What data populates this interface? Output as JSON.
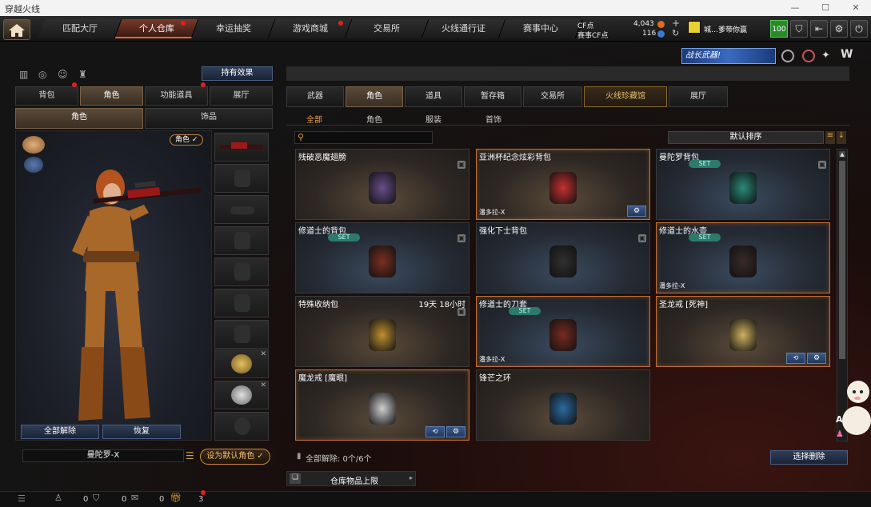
{
  "window": {
    "title": "穿越火线",
    "minimize": "—",
    "maximize": "☐",
    "close": "✕"
  },
  "nav": {
    "tabs": [
      "匹配大厅",
      "个人仓库",
      "幸运抽奖",
      "游戏商城",
      "交易所",
      "火线通行证",
      "赛事中心"
    ],
    "active_index": 1
  },
  "currency": {
    "cf_label": "CF点",
    "cf_value": "4,043",
    "match_cf_label": "赛事CF点",
    "match_cf_value": "116"
  },
  "player": {
    "name": "城…爹带你赢",
    "level": "100"
  },
  "banner": {
    "text": "战长武器!"
  },
  "left": {
    "effect_button": "持有效果",
    "tabs": [
      "背包",
      "角色",
      "功能道具",
      "展厅"
    ],
    "active_tab": 1,
    "subtabs": [
      "角色",
      "饰品"
    ],
    "role_badge": "角色 ✓",
    "unequip_all": "全部解除",
    "restore": "恢复",
    "character_name": "曼陀罗-X",
    "set_default": "设为默认角色 ✓"
  },
  "right": {
    "tabs": [
      "武器",
      "角色",
      "道具",
      "暂存箱",
      "交易所",
      "火线珍藏馆",
      "展厅"
    ],
    "active_tab": 1,
    "special_tab": 5,
    "subtabs": [
      "全部",
      "角色",
      "服装",
      "首饰"
    ],
    "active_subtab": 0,
    "search_placeholder": "",
    "sort_label": "默认排序",
    "items": [
      {
        "name": "残破恶魔翅膀",
        "time": "",
        "set": false,
        "owner": "",
        "style": "brown",
        "selected": false,
        "lock": true,
        "gear": false,
        "convert": false
      },
      {
        "name": "亚洲杯纪念炫彩背包",
        "time": "",
        "set": false,
        "owner": "潘多拉-X",
        "style": "brown",
        "selected": true,
        "lock": false,
        "gear": true,
        "convert": false
      },
      {
        "name": "曼陀罗背包",
        "time": "",
        "set": true,
        "owner": "",
        "style": "blue",
        "selected": false,
        "lock": true,
        "gear": false,
        "convert": false
      },
      {
        "name": "修道士的背包",
        "time": "",
        "set": true,
        "owner": "",
        "style": "blue",
        "selected": false,
        "lock": true,
        "gear": false,
        "convert": false
      },
      {
        "name": "强化下士背包",
        "time": "",
        "set": false,
        "owner": "",
        "style": "blue",
        "selected": false,
        "lock": true,
        "gear": false,
        "convert": false
      },
      {
        "name": "修道士的水壶",
        "time": "",
        "set": true,
        "owner": "潘多拉-X",
        "style": "blue",
        "selected": true,
        "lock": false,
        "gear": false,
        "convert": false
      },
      {
        "name": "特殊收纳包",
        "time": "19天 18小时",
        "set": false,
        "owner": "",
        "style": "brown",
        "selected": false,
        "lock": true,
        "gear": false,
        "convert": false
      },
      {
        "name": "修道士的刀套",
        "time": "",
        "set": true,
        "owner": "潘多拉-X",
        "style": "blue",
        "selected": true,
        "lock": false,
        "gear": false,
        "convert": false
      },
      {
        "name": "圣龙戒 [死神]",
        "time": "",
        "set": false,
        "owner": "",
        "style": "brown",
        "selected": true,
        "lock": false,
        "gear": true,
        "convert": true
      },
      {
        "name": "魔龙戒 [魔眼]",
        "time": "",
        "set": false,
        "owner": "",
        "style": "brown",
        "selected": true,
        "lock": false,
        "gear": true,
        "convert": true
      },
      {
        "name": "锋芒之环",
        "time": "",
        "set": false,
        "owner": "",
        "style": "brown",
        "selected": false,
        "lock": false,
        "gear": false,
        "convert": false
      }
    ],
    "unequip_count_label": "全部解除: 0个/6个",
    "select_delete": "选择删除",
    "capacity_label": "仓库物品上限"
  },
  "statusbar": {
    "count1": "0",
    "count2": "0",
    "count3": "0",
    "count4": "3"
  },
  "colors": {
    "accent": "#e86a2a",
    "selected_border": "#c0703a",
    "set_badge": "#2e7a6a",
    "blue_button": "#3b5a8a"
  }
}
